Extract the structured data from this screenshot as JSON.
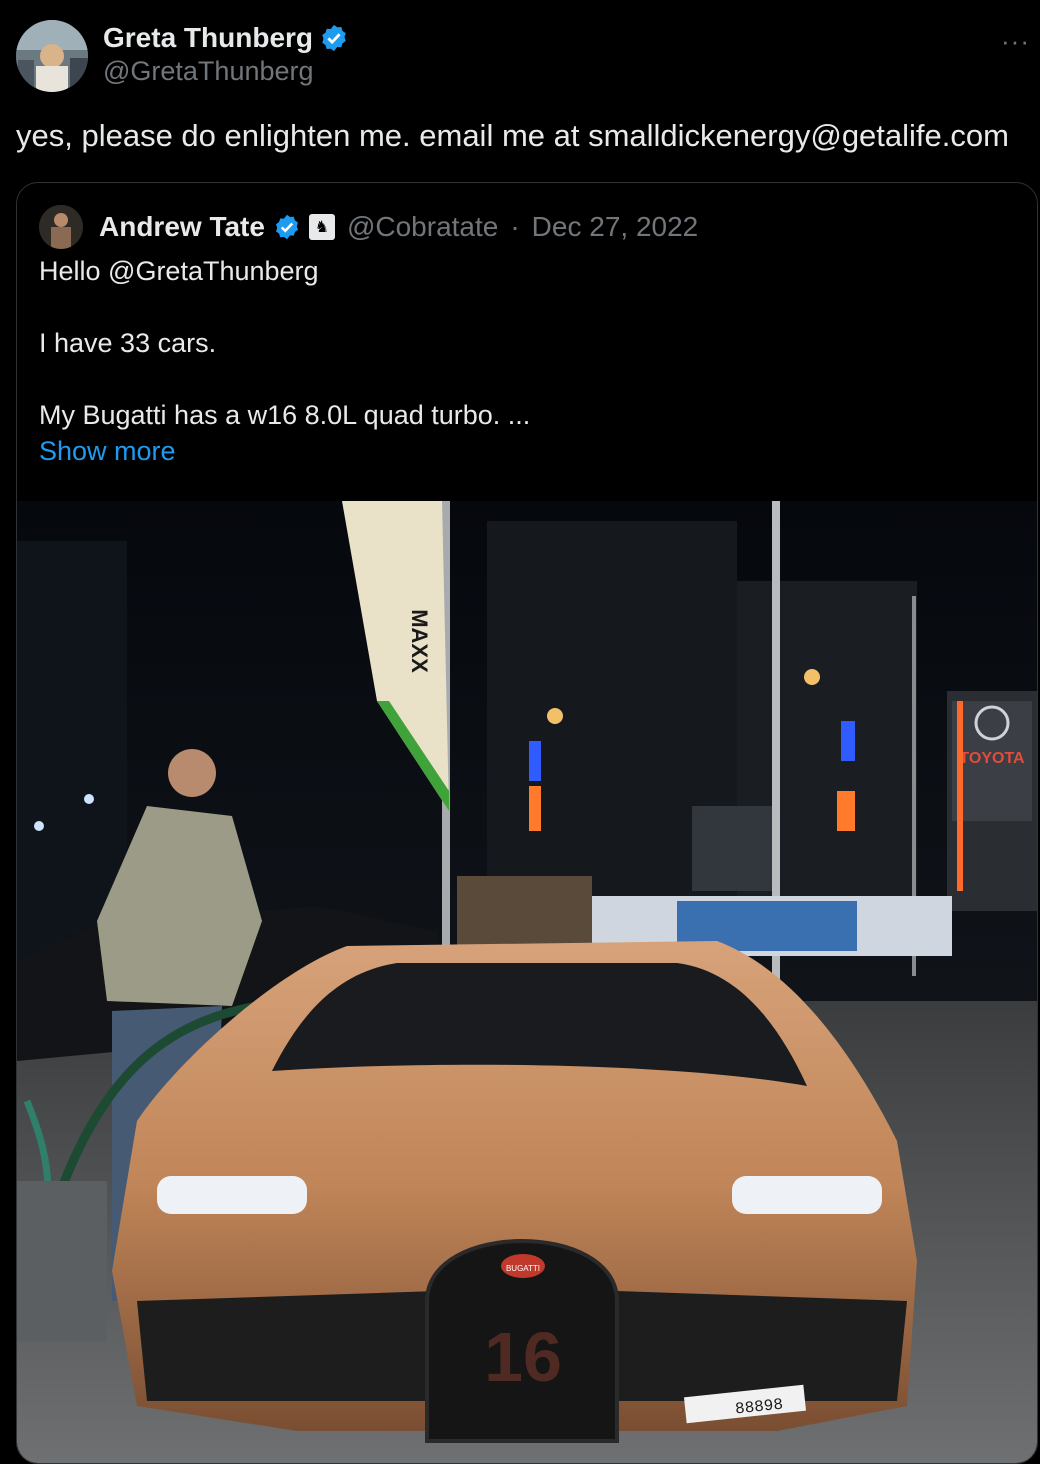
{
  "tweet": {
    "author_name": "Greta Thunberg",
    "author_handle": "@GretaThunberg",
    "text": "yes, please do enlighten me. email me at smalldickenergy@getalife.com",
    "more_icon": "more-horizontal-icon"
  },
  "quote": {
    "author_name": "Andrew Tate",
    "author_handle": "@Cobratate",
    "separator": "·",
    "date": "Dec 27, 2022",
    "lines": {
      "l1": "Hello @GretaThunberg",
      "l2": "I have 33 cars.",
      "l3": "My Bugatti has a w16 8.0L quad turbo. ..."
    },
    "show_more": "Show more",
    "image": {
      "flag_text": "MAXX",
      "sign_text": "TOYOTA",
      "plate_text": "88898",
      "grille_number": "16",
      "emblem_text": "BUGATTI"
    }
  },
  "colors": {
    "background": "#000000",
    "text": "#e7e9ea",
    "muted": "#71767b",
    "link": "#1d9bf0",
    "verified": "#1d9bf0",
    "car": "#c98f62"
  }
}
